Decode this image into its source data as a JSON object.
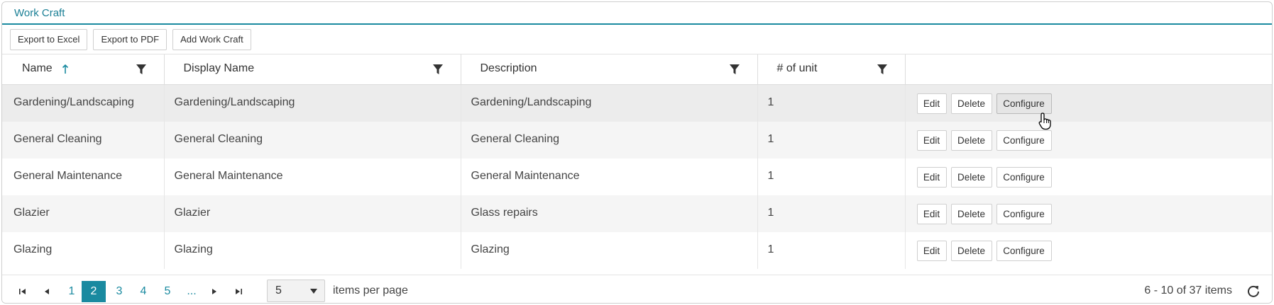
{
  "panel": {
    "title": "Work Craft"
  },
  "toolbar": {
    "export_excel": "Export to Excel",
    "export_pdf": "Export to PDF",
    "add": "Add Work Craft"
  },
  "columns": [
    {
      "label": "Name",
      "sorted": "ascending"
    },
    {
      "label": "Display Name"
    },
    {
      "label": "Description"
    },
    {
      "label": "# of unit"
    },
    {
      "label": ""
    }
  ],
  "rows": [
    {
      "name": "Gardening/Landscaping",
      "display_name": "Gardening/Landscaping",
      "description": "Gardening/Landscaping",
      "units": "1"
    },
    {
      "name": "General Cleaning",
      "display_name": "General Cleaning",
      "description": "General Cleaning",
      "units": "1"
    },
    {
      "name": "General Maintenance",
      "display_name": "General Maintenance",
      "description": "General Maintenance",
      "units": "1"
    },
    {
      "name": "Glazier",
      "display_name": "Glazier",
      "description": "Glass repairs",
      "units": "1"
    },
    {
      "name": "Glazing",
      "display_name": "Glazing",
      "description": "Glazing",
      "units": "1"
    }
  ],
  "row_actions": {
    "edit": "Edit",
    "delete": "Delete",
    "configure": "Configure"
  },
  "pager": {
    "pages": [
      "1",
      "2",
      "3",
      "4",
      "5",
      "..."
    ],
    "current_page": "2",
    "page_size": "5",
    "items_per_page_label": "items per page",
    "summary": "6 - 10 of 37 items"
  },
  "colors": {
    "accent": "#1a8aa0"
  }
}
